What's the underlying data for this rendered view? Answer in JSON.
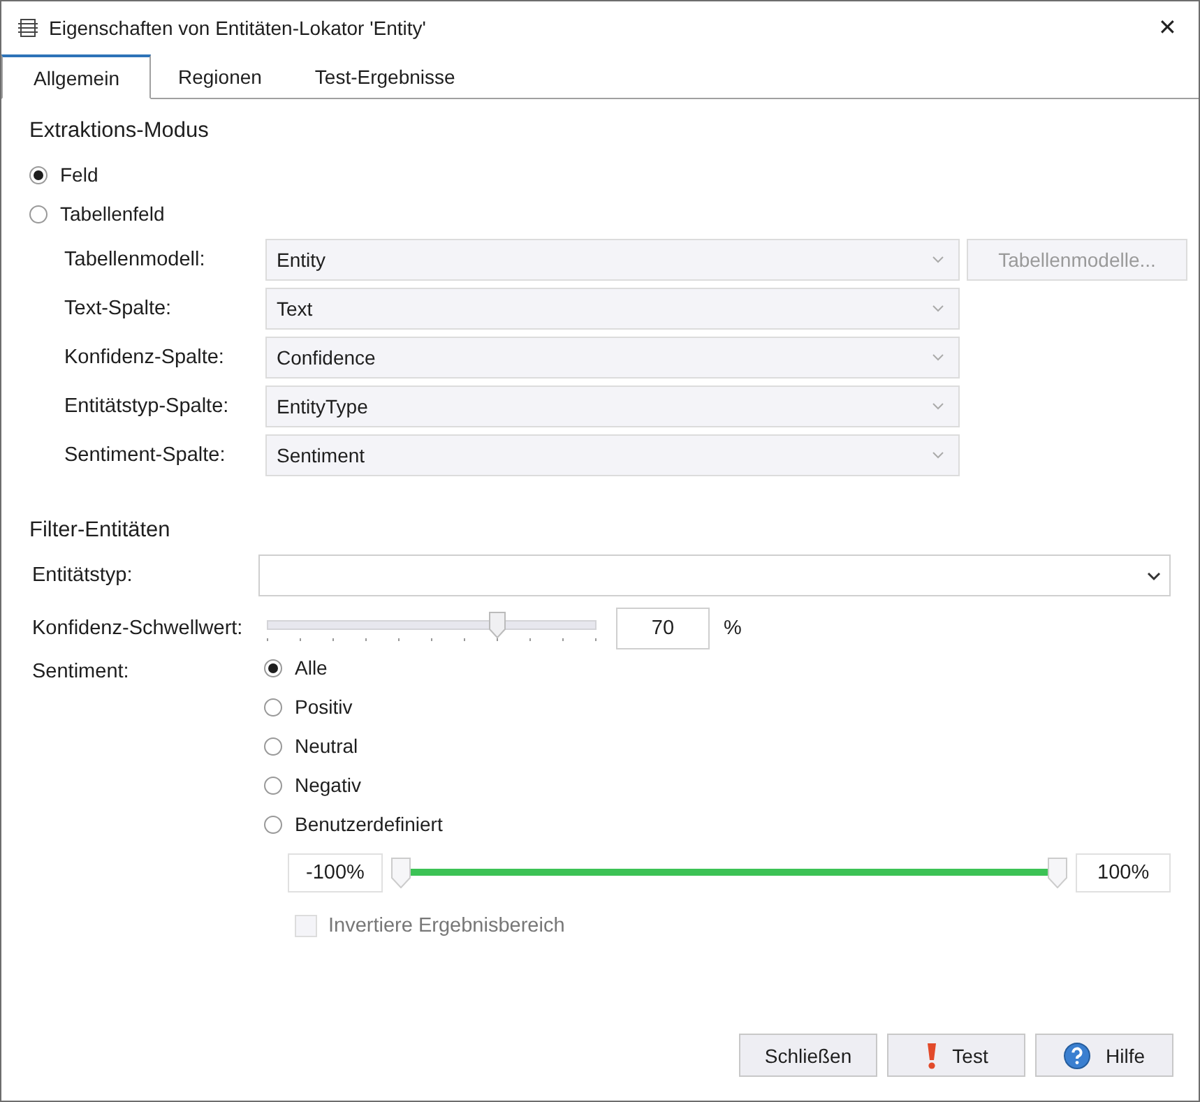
{
  "window": {
    "title": "Eigenschaften von Entitäten-Lokator 'Entity'",
    "close": "✕"
  },
  "tabs": [
    {
      "label": "Allgemein",
      "selected": true
    },
    {
      "label": "Regionen",
      "selected": false
    },
    {
      "label": "Test-Ergebnisse",
      "selected": false
    }
  ],
  "extraction": {
    "heading": "Extraktions-Modus",
    "modes": [
      {
        "label": "Feld",
        "selected": true
      },
      {
        "label": "Tabellenfeld",
        "selected": false
      }
    ],
    "fields": [
      {
        "label": "Tabellenmodell:",
        "value": "Entity",
        "disabled": true,
        "button": "Tabellenmodelle..."
      },
      {
        "label": "Text-Spalte:",
        "value": "Text",
        "disabled": true
      },
      {
        "label": "Konfidenz-Spalte:",
        "value": "Confidence",
        "disabled": true
      },
      {
        "label": "Entitätstyp-Spalte:",
        "value": "EntityType",
        "disabled": true
      },
      {
        "label": "Sentiment-Spalte:",
        "value": "Sentiment",
        "disabled": true
      }
    ]
  },
  "filter": {
    "heading": "Filter-Entitäten",
    "entity_type": {
      "label": "Entitätstyp:"
    },
    "confidence": {
      "label": "Konfidenz-Schwellwert:",
      "level": 0.7,
      "value": "70",
      "unit": "%"
    },
    "sentiment": {
      "label": "Sentiment:",
      "options": [
        {
          "label": "Alle",
          "selected": true
        },
        {
          "label": "Positiv",
          "selected": false
        },
        {
          "label": "Neutral",
          "selected": false
        },
        {
          "label": "Negativ",
          "selected": false
        },
        {
          "label": "Benutzerdefiniert",
          "selected": false
        }
      ],
      "range": {
        "min_value": "-100%",
        "max_value": "100%",
        "low": {
          "level": 0
        },
        "high": {
          "level": 1
        }
      },
      "invert": {
        "label": "Invertiere Ergebnisbereich",
        "checked": false,
        "disabled": true
      }
    }
  },
  "buttons": [
    {
      "label": "Schließen",
      "kind": "plain"
    },
    {
      "label": "Test",
      "kind": "test"
    },
    {
      "label": "Hilfe",
      "kind": "help"
    }
  ]
}
